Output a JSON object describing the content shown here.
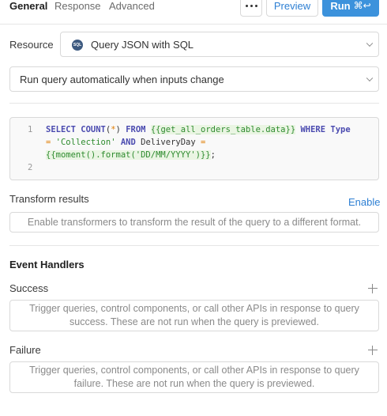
{
  "tabs": [
    {
      "label": "General",
      "active": true
    },
    {
      "label": "Response",
      "active": false
    },
    {
      "label": "Advanced",
      "active": false
    }
  ],
  "toolbar": {
    "more_icon": "ellipsis-icon",
    "preview_label": "Preview",
    "run_label": "Run",
    "run_shortcut": "⌘↩"
  },
  "resource": {
    "label": "Resource",
    "value": "Query JSON with SQL",
    "icon": "sql-icon",
    "icon_text": "SQL"
  },
  "trigger": {
    "value": "Run query automatically when inputs change"
  },
  "code": {
    "line_numbers": [
      "1",
      "2"
    ]
  },
  "transform": {
    "label": "Transform results",
    "enable_label": "Enable",
    "placeholder": "Enable transformers to transform the result of the query to a different format."
  },
  "event_handlers": {
    "title": "Event Handlers",
    "success": {
      "label": "Success",
      "placeholder": "Trigger queries, control components, or call other APIs in response to query success. These are not run when the query is previewed."
    },
    "failure": {
      "label": "Failure",
      "placeholder": "Trigger queries, control components, or call other APIs in response to query failure. These are not run when the query is previewed."
    }
  },
  "colors": {
    "accent": "#3c92dc",
    "link": "#2d7fd3",
    "keyword": "#4b4bb0",
    "string": "#2e8b2e",
    "operator": "#e07b00"
  }
}
